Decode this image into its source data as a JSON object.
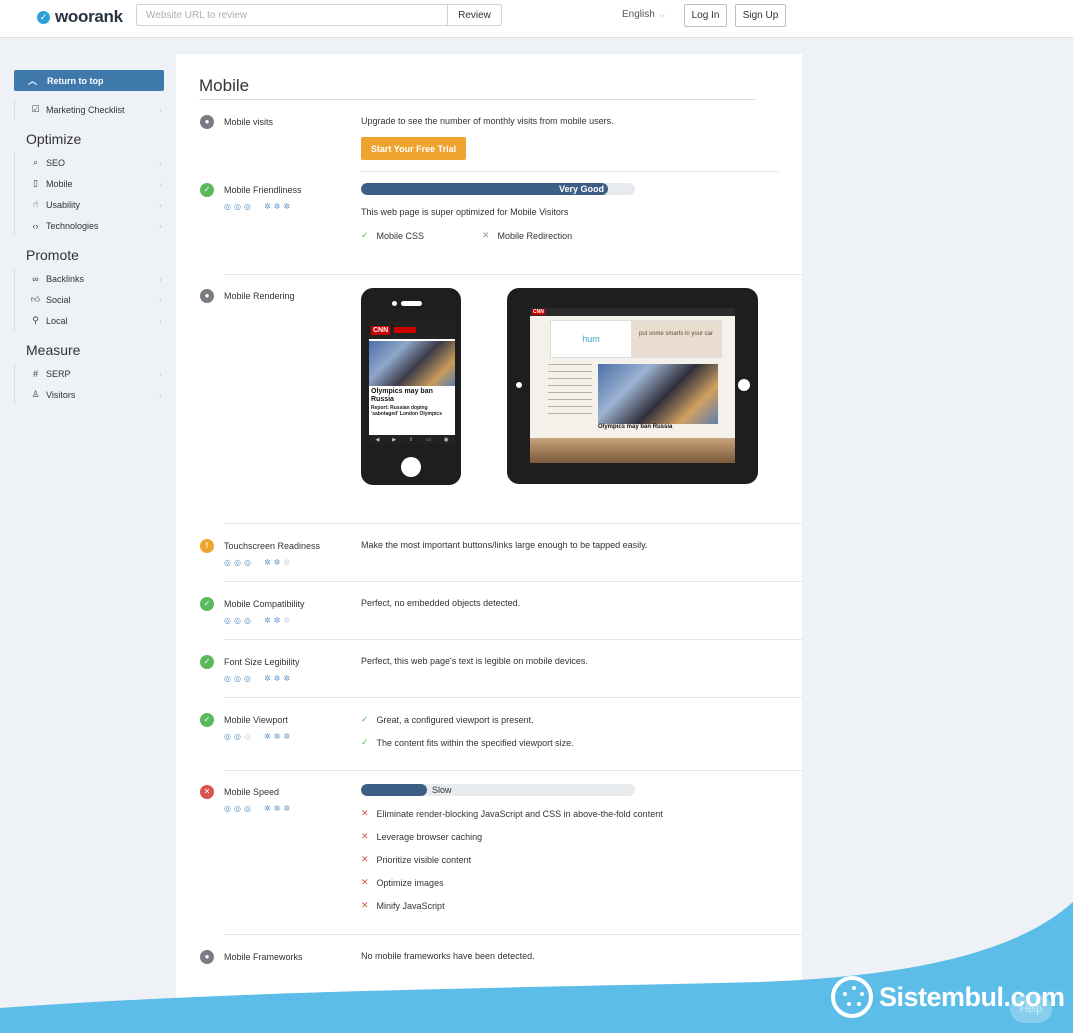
{
  "header": {
    "brand": "woorank",
    "url_placeholder": "Website URL to review",
    "review_label": "Review",
    "language": "English",
    "login_label": "Log In",
    "signup_label": "Sign Up"
  },
  "sidebar": {
    "return_label": "Return to top",
    "checklist_label": "Marketing Checklist",
    "groups": [
      {
        "heading": "Optimize",
        "items": [
          {
            "label": "SEO",
            "icon": "search-icon"
          },
          {
            "label": "Mobile",
            "icon": "mobile-icon"
          },
          {
            "label": "Usability",
            "icon": "usability-icon"
          },
          {
            "label": "Technologies",
            "icon": "code-icon"
          }
        ]
      },
      {
        "heading": "Promote",
        "items": [
          {
            "label": "Backlinks",
            "icon": "link-icon"
          },
          {
            "label": "Social",
            "icon": "thumbs-up-icon"
          },
          {
            "label": "Local",
            "icon": "pin-icon"
          }
        ]
      },
      {
        "heading": "Measure",
        "items": [
          {
            "label": "SERP",
            "icon": "hash-icon"
          },
          {
            "label": "Visitors",
            "icon": "user-icon"
          }
        ]
      }
    ]
  },
  "main": {
    "title": "Mobile",
    "rows": {
      "visits": {
        "label": "Mobile visits",
        "text": "Upgrade to see the number of monthly visits from mobile users.",
        "button": "Start Your Free Trial"
      },
      "friendliness": {
        "label": "Mobile Friendliness",
        "meter_label": "Very Good",
        "meter_fraction": 0.9,
        "text": "This web page is super optimized for Mobile Visitors",
        "check_pass": "Mobile CSS",
        "check_fail": "Mobile Redirection"
      },
      "rendering": {
        "label": "Mobile Rendering",
        "phone_headline": "Olympics may ban Russia",
        "phone_sub": "Report: Russian doping 'sabotaged' London Olympics",
        "tablet_ad_left": "hum",
        "tablet_ad_right": "put some smarts in your car",
        "tablet_caption": "Olympics may ban Russia"
      },
      "touchscreen": {
        "label": "Touchscreen Readiness",
        "text": "Make the most important buttons/links large enough to be tapped easily."
      },
      "compatibility": {
        "label": "Mobile Compatibility",
        "text": "Perfect, no embedded objects detected."
      },
      "font": {
        "label": "Font Size Legibility",
        "text": "Perfect, this web page's text is legible on mobile devices."
      },
      "viewport": {
        "label": "Mobile Viewport",
        "check1": "Great, a configured viewport is present.",
        "check2": "The content fits within the specified viewport size."
      },
      "speed": {
        "label": "Mobile Speed",
        "meter_label": "Slow",
        "meter_fraction": 0.24,
        "items": [
          "Eliminate render-blocking JavaScript and CSS in above-the-fold content",
          "Leverage browser caching",
          "Prioritize visible content",
          "Optimize images",
          "Minify JavaScript"
        ]
      },
      "frameworks": {
        "label": "Mobile Frameworks",
        "text": "No mobile frameworks have been detected."
      }
    }
  },
  "watermark": {
    "text": "Sistembul.com",
    "help": "Help"
  },
  "colors": {
    "accent": "#3f78ab",
    "meter": "#3c5e84",
    "pass": "#5cb85c",
    "warn": "#f0a430",
    "fail": "#d9534f",
    "trial": "#f0a430",
    "wave": "#5bbde8"
  }
}
